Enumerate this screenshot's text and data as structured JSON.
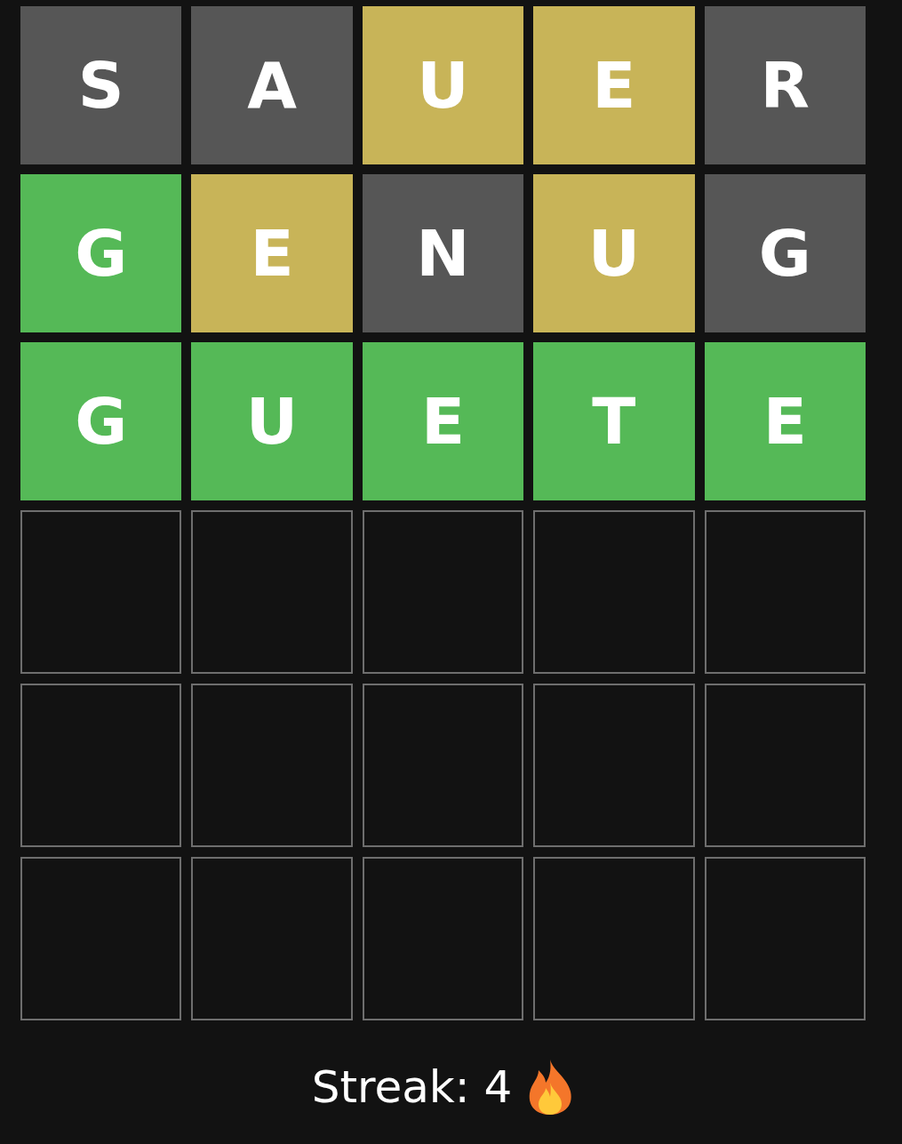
{
  "rows": [
    {
      "tiles": [
        {
          "letter": "S",
          "kind": "absent"
        },
        {
          "letter": "A",
          "kind": "absent"
        },
        {
          "letter": "U",
          "kind": "present"
        },
        {
          "letter": "E",
          "kind": "present"
        },
        {
          "letter": "R",
          "kind": "absent"
        }
      ]
    },
    {
      "tiles": [
        {
          "letter": "G",
          "kind": "correct"
        },
        {
          "letter": "E",
          "kind": "present"
        },
        {
          "letter": "N",
          "kind": "absent"
        },
        {
          "letter": "U",
          "kind": "present"
        },
        {
          "letter": "G",
          "kind": "absent"
        }
      ]
    },
    {
      "tiles": [
        {
          "letter": "G",
          "kind": "correct"
        },
        {
          "letter": "U",
          "kind": "correct"
        },
        {
          "letter": "E",
          "kind": "correct"
        },
        {
          "letter": "T",
          "kind": "correct"
        },
        {
          "letter": "E",
          "kind": "correct"
        }
      ]
    },
    {
      "tiles": [
        {
          "kind": "empty"
        },
        {
          "kind": "empty"
        },
        {
          "kind": "empty"
        },
        {
          "kind": "empty"
        },
        {
          "kind": "empty"
        }
      ]
    },
    {
      "tiles": [
        {
          "kind": "empty"
        },
        {
          "kind": "empty"
        },
        {
          "kind": "empty"
        },
        {
          "kind": "empty"
        },
        {
          "kind": "empty"
        }
      ]
    },
    {
      "tiles": [
        {
          "kind": "empty"
        },
        {
          "kind": "empty"
        },
        {
          "kind": "empty"
        },
        {
          "kind": "empty"
        },
        {
          "kind": "empty"
        }
      ]
    }
  ],
  "streak": "Streak: 4"
}
